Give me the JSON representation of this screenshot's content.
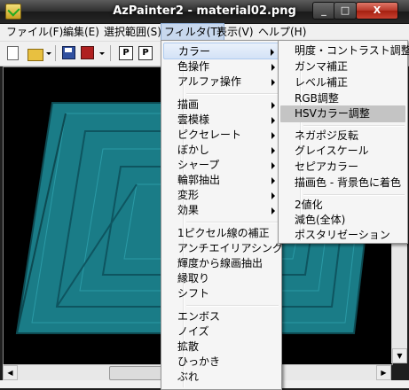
{
  "window": {
    "title": "AzPainter2 - material02.png",
    "controls": {
      "minimize": "_",
      "maximize": "□",
      "close": "X"
    }
  },
  "menubar": [
    "ファイル(F)",
    "編集(E)",
    "選択範囲(S)",
    "フィルタ(T)",
    "表示(V)",
    "ヘルプ(H)"
  ],
  "toolbar": {
    "icons": [
      "new-icon",
      "open-icon",
      "dropdown-arrow-icon",
      "save-icon",
      "save-as-icon",
      "dropdown-arrow-icon",
      "tool-p1-icon",
      "tool-p2-icon"
    ],
    "glyphs": {
      "p1": "P",
      "p2": "P"
    }
  },
  "filter_menu": {
    "items": [
      {
        "label": "カラー",
        "submenu": true
      },
      {
        "label": "色操作",
        "submenu": true
      },
      {
        "label": "アルファ操作",
        "submenu": true
      },
      {
        "label": "描画",
        "submenu": true
      },
      {
        "label": "雲模様",
        "submenu": true
      },
      {
        "label": "ピクセレート",
        "submenu": true
      },
      {
        "label": "ぼかし",
        "submenu": true
      },
      {
        "label": "シャープ",
        "submenu": true
      },
      {
        "label": "輪郭抽出",
        "submenu": true
      },
      {
        "label": "変形",
        "submenu": true
      },
      {
        "label": "効果",
        "submenu": true
      },
      {
        "label": "1ピクセル線の補正",
        "submenu": false
      },
      {
        "label": "アンチエイリアシング",
        "submenu": false
      },
      {
        "label": "輝度から線画抽出",
        "submenu": false
      },
      {
        "label": "縁取り",
        "submenu": false
      },
      {
        "label": "シフト",
        "submenu": false
      },
      {
        "label": "エンボス",
        "submenu": false
      },
      {
        "label": "ノイズ",
        "submenu": false
      },
      {
        "label": "拡散",
        "submenu": false
      },
      {
        "label": "ひっかき",
        "submenu": false
      },
      {
        "label": "ぶれ",
        "submenu": false
      }
    ]
  },
  "color_submenu": {
    "items": [
      "明度・コントラスト調整",
      "ガンマ補正",
      "レベル補正",
      "RGB調整",
      "HSVカラー調整",
      "ネガポジ反転",
      "グレイスケール",
      "セピアカラー",
      "描画色 - 背景色に着色",
      "2値化",
      "減色(全体)",
      "ポスタリゼーション"
    ]
  },
  "scrollbars": {
    "up": "▲",
    "down": "▼",
    "left": "◀",
    "right": "▶"
  },
  "colors": {
    "canvas_fill": "#1c7f8a",
    "canvas_bg": "#000000",
    "menu_bg": "#f5f5f5"
  }
}
